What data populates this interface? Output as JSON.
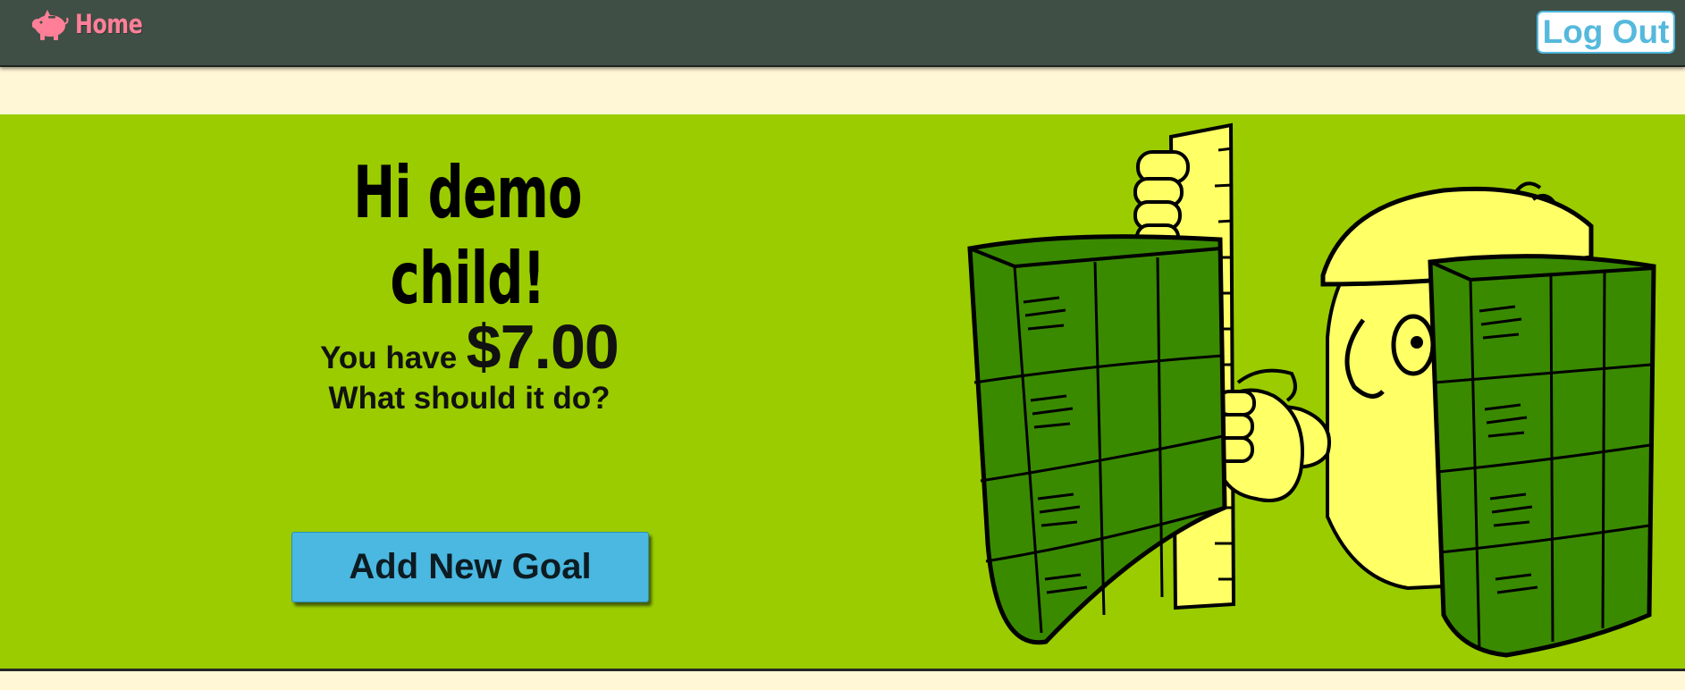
{
  "nav": {
    "home_label": "Home",
    "home_icon": "piggy-bank-icon",
    "logout_label": "Log Out"
  },
  "hero": {
    "greeting": "Hi demo child!",
    "balance_prefix": "You have",
    "balance_amount": "$7.00",
    "question": "What should it do?",
    "add_goal_label": "Add New Goal",
    "illustration": "boy-measuring-money-stacks-illustration"
  },
  "colors": {
    "topbar": "#3f4f45",
    "page_background": "#fff7d6",
    "hero_background": "#9acc00",
    "home_pink": "#ff7f98",
    "logout_blue": "#55b9dd",
    "button_blue": "#4ab8e0",
    "money_green": "#3a8a00",
    "character_yellow": "#ffff66"
  }
}
